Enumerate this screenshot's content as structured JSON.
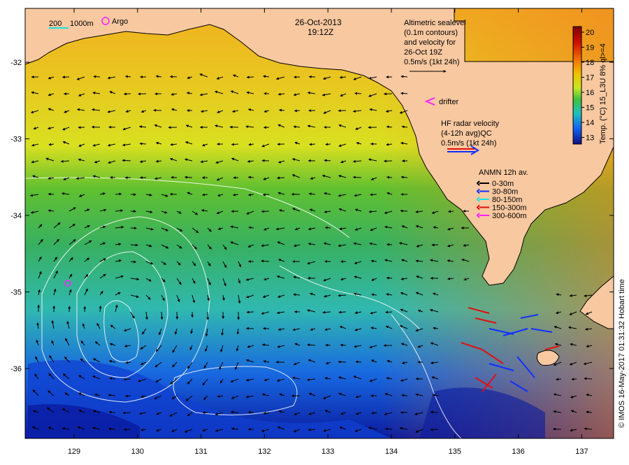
{
  "header": {
    "date": "26-Oct-2013",
    "time": "19:12Z",
    "argo_label": "Argo",
    "scale_200": "200",
    "scale_1000": "1000m"
  },
  "legend": {
    "altimetry_lines": [
      "Altimetric sealevel",
      "(0.1m contours)",
      "and velocity for",
      "26-Oct 19Z",
      "0.5m/s (1kt 24h)"
    ],
    "drifter_label": "drifter",
    "hf_lines": [
      "HF radar velocity",
      "(4-12h avg)QC",
      "0.5m/s (1kt 24h)"
    ],
    "anmn_title": "ANMN 12h av.",
    "anmn_items": [
      {
        "label": "0-30m",
        "color": "#000000"
      },
      {
        "label": "30-80m",
        "color": "#1030ff"
      },
      {
        "label": "80-150m",
        "color": "#20e0e0"
      },
      {
        "label": "150-300m",
        "color": "#e01010"
      },
      {
        "label": "300-600m",
        "color": "#ff20ff"
      }
    ]
  },
  "colorbar": {
    "title": "Temp. (°C) 15_L3U 8% ql>=4",
    "ticks": [
      "20",
      "19",
      "18",
      "17",
      "16",
      "15",
      "14",
      "13"
    ],
    "colors": [
      "#800000",
      "#d01000",
      "#f07000",
      "#f0c000",
      "#c8e820",
      "#40c040",
      "#20c0c0",
      "#1060f0",
      "#101080"
    ]
  },
  "axes": {
    "x_ticks": [
      "129",
      "130",
      "131",
      "132",
      "133",
      "134",
      "135",
      "136",
      "137"
    ],
    "y_ticks": [
      "-32",
      "-33",
      "-34",
      "-35",
      "-36"
    ]
  },
  "credit": "© IMOS 16-May-2017 01:31:32 Hobart time",
  "colors": {
    "land": "#f8c8a0",
    "sst_warm": "#f0b020",
    "sst_yellow": "#e8e020",
    "sst_green": "#60c030",
    "sst_teal": "#30b8a0",
    "sst_blue": "#1868e0",
    "sst_dark": "#0a1aa0"
  }
}
